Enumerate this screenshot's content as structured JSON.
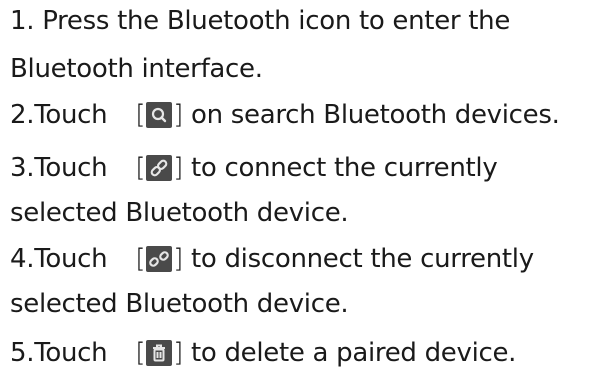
{
  "steps": [
    {
      "number": "1.",
      "lines": [
        "Press the Bluetooth icon to enter the",
        "Bluetooth interface."
      ]
    },
    {
      "number": "2.",
      "touch": "Touch",
      "open_bracket": "[",
      "close_bracket": "]",
      "icon": "search-icon",
      "text": "on search Bluetooth devices."
    },
    {
      "number": "3.",
      "touch": "Touch",
      "open_bracket": "[",
      "close_bracket": "]",
      "icon": "link-icon",
      "text": "to connect the currently",
      "continuation": "selected Bluetooth device."
    },
    {
      "number": "4.",
      "touch": "Touch",
      "open_bracket": "[",
      "close_bracket": "]",
      "icon": "unlink-icon",
      "text": "to disconnect the currently",
      "continuation": "selected Bluetooth device."
    },
    {
      "number": "5.",
      "touch": "Touch",
      "open_bracket": "[",
      "close_bracket": "]",
      "icon": "trash-icon",
      "text": "to delete a paired device."
    }
  ],
  "colors": {
    "text": "#1a1a1a",
    "icon_bg": "#4a4a4a",
    "icon_fg": "#e6e6e6",
    "page_bg": "#ffffff"
  }
}
